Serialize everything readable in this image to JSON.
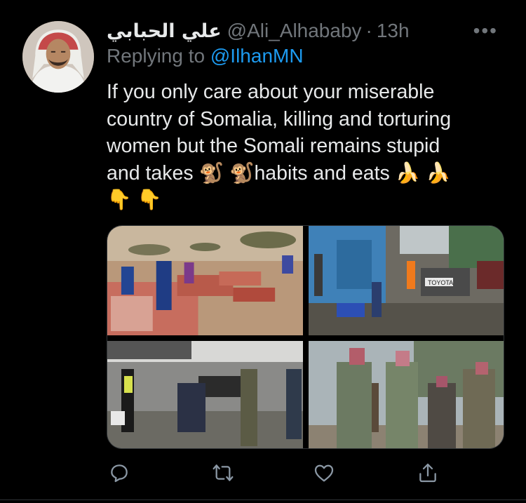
{
  "tweet": {
    "display_name": "علي الحبابي",
    "handle": "@Ali_Alhababy",
    "separator": "·",
    "time": "13h",
    "more_label": "•••",
    "replying_prefix": "Replying to",
    "replying_mention": "@IlhanMN",
    "text_line1": "If you only care about your miserable",
    "text_line2": "country of Somalia, killing and torturing",
    "text_line3": "women but the Somali remains stupid",
    "text_line4a": "and takes ",
    "emoji_monkey": "🐒",
    "text_line4b": "habits and eats ",
    "emoji_banana": "🍌",
    "emoji_pointing_down": "👇"
  },
  "media": {
    "photos": [
      "food-aid-distribution-photo",
      "street-damage-photo",
      "explosion-aftermath-photo",
      "armed-militants-photo"
    ],
    "plate_text": "TOYOTA"
  },
  "actions": [
    "reply-icon",
    "retweet-icon",
    "like-icon",
    "share-icon"
  ],
  "colors": {
    "background": "#000000",
    "text": "#e7e9ea",
    "secondary": "#71767b",
    "link": "#1d9bf0"
  }
}
